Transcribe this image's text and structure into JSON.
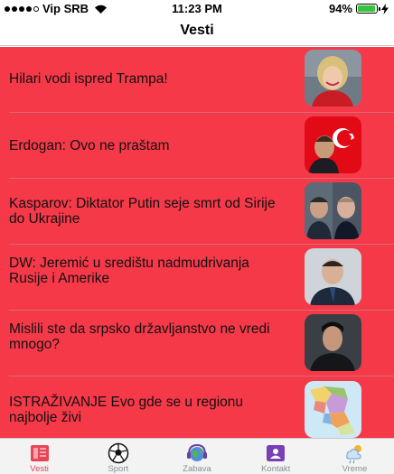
{
  "status": {
    "carrier": "Vip SRB",
    "time": "11:23 PM",
    "battery": "94%",
    "battery_level": 0.94
  },
  "header": {
    "title": "Vesti"
  },
  "news": [
    {
      "title": "Hilari vodi ispred Trampa!",
      "image": "hillary-photo"
    },
    {
      "title": "Erdogan: Ovo ne praštam",
      "image": "erdogan-turkish-flag-photo"
    },
    {
      "title": "Kasparov: Diktator Putin seje smrt od Sirije do Ukrajine",
      "image": "kasparov-putin-photo"
    },
    {
      "title": "DW: Jeremić u središtu nadmudrivanja Rusije i Amerike",
      "image": "jeremic-photo"
    },
    {
      "title": "Mislili ste da srpsko državljanstvo ne vredi mnogo?",
      "image": "seagal-photo"
    },
    {
      "title": "ISTRAŽIVANJE Evo gde se u regionu najbolje živi",
      "image": "balkan-map-image"
    }
  ],
  "tabs": [
    {
      "label": "Vesti",
      "icon": "newspaper-icon",
      "active": true
    },
    {
      "label": "Sport",
      "icon": "soccer-ball-icon",
      "active": false
    },
    {
      "label": "Zabava",
      "icon": "globe-headphones-icon",
      "active": false
    },
    {
      "label": "Kontakt",
      "icon": "contact-card-icon",
      "active": false
    },
    {
      "label": "Vreme",
      "icon": "weather-icon",
      "active": false
    }
  ],
  "colors": {
    "list_background": "#f63949",
    "active_tab": "#e84657",
    "inactive_tab": "#8e8e93",
    "battery_green": "#37c33b"
  }
}
